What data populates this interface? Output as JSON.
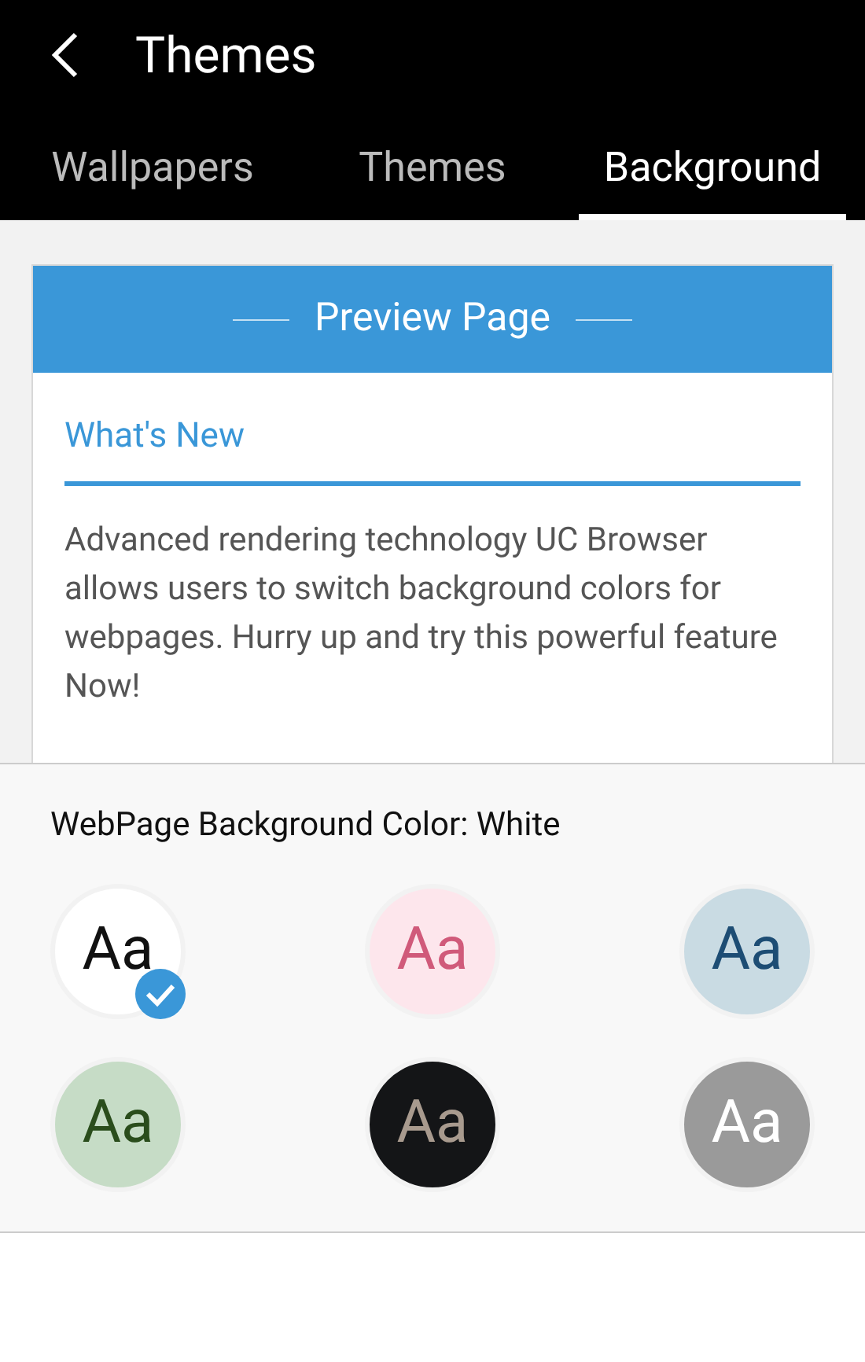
{
  "header": {
    "title": "Themes"
  },
  "tabs": [
    {
      "label": "Wallpapers",
      "selected": false
    },
    {
      "label": "Themes",
      "selected": false
    },
    {
      "label": "Background",
      "selected": true
    }
  ],
  "preview": {
    "title": "Preview Page",
    "heading": "What's New",
    "body": "Advanced rendering technology UC Browser allows users to switch background colors for webpages. Hurry up and try this powerful feature Now!"
  },
  "background_color": {
    "label": "WebPage Background Color: White",
    "swatches": [
      {
        "sample": "Aa",
        "kind": "white",
        "color": "#ffffff",
        "selected": true
      },
      {
        "sample": "Aa",
        "kind": "pink",
        "color": "#fde6ec",
        "selected": false
      },
      {
        "sample": "Aa",
        "kind": "blue",
        "color": "#c9dbe3",
        "selected": false
      },
      {
        "sample": "Aa",
        "kind": "green",
        "color": "#c6dcc6",
        "selected": false
      },
      {
        "sample": "Aa",
        "kind": "black",
        "color": "#141517",
        "selected": false
      },
      {
        "sample": "Aa",
        "kind": "gray",
        "color": "#9a9a9a",
        "selected": false
      }
    ]
  }
}
